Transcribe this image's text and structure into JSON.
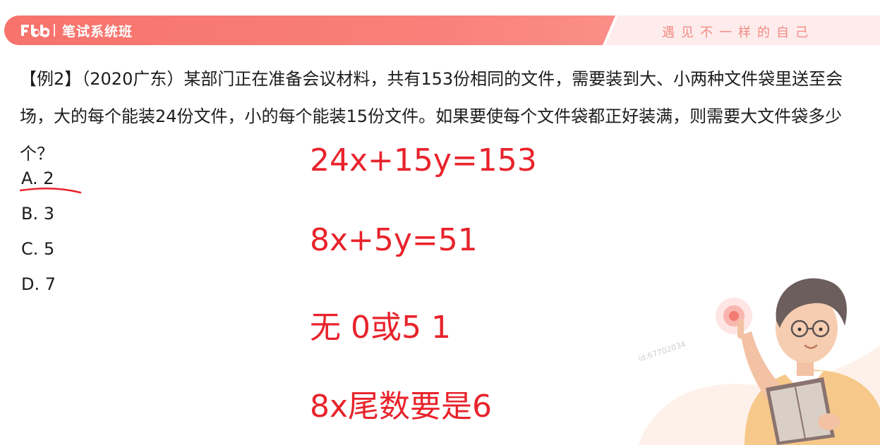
{
  "header": {
    "brand": "笔试系统班",
    "slogan": "遇见不一样的自己"
  },
  "question": {
    "text": "【例2】（2020广东）某部门正在准备会议材料，共有153份相同的文件，需要装到大、小两种文件袋里送至会场，大的每个能装24份文件，小的每个能装15份文件。如果要使每个文件袋都正好装满，则需要大文件袋多少个？"
  },
  "options": [
    {
      "label": "A. 2"
    },
    {
      "label": "B. 3"
    },
    {
      "label": "C. 5"
    },
    {
      "label": "D. 7"
    }
  ],
  "annotations": {
    "eq1": "24x+15y=153",
    "eq2": "8x+5y=51",
    "note1": "无 0或5 1",
    "note2": "8x尾数要是6"
  },
  "watermark": "id:67702034",
  "colors": {
    "banner": "#f7736c",
    "annotation": "#e8232b"
  }
}
